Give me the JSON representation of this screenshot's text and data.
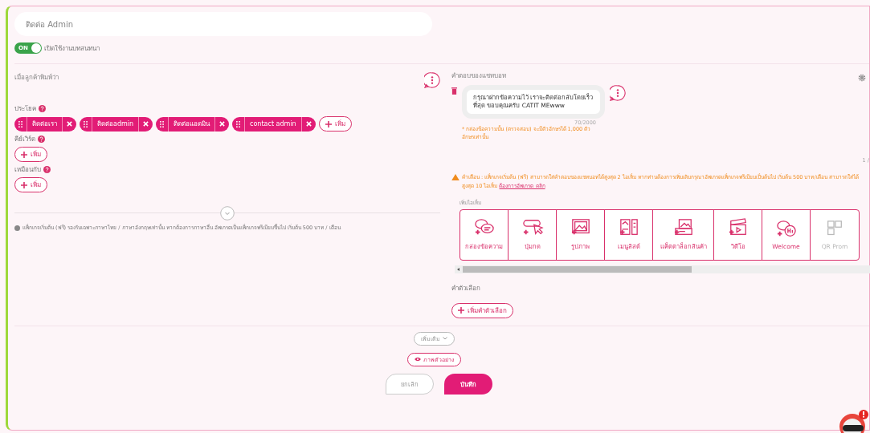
{
  "title_field": {
    "value": "ติดต่อ Admin"
  },
  "toggle": {
    "on": true,
    "label": "ON",
    "text": "เปิดใช้งานบทสนทนา"
  },
  "trigger": {
    "heading": "เมื่อลูกค้าพิมพ์ว่า",
    "groups": [
      {
        "label": "ประโยค",
        "add": "เพิ่ม",
        "tags": [
          "ติดต่อเรา",
          "ติดต่อadmin",
          "ติดต่อแอดมิน",
          "contact admin"
        ]
      },
      {
        "label": "คีย์เวิร์ด",
        "add": "เพิ่ม"
      },
      {
        "label": "เหมือนกับ",
        "add": "เพิ่ม"
      }
    ],
    "note": "แพ็กเกจเริ่มต้น (ฟรี) รองรับเฉพาะภาษาไทย / ภาษาอังกฤษเท่านั้น หากต้องการภาษาอื่น อัพเกรดเป็นแพ็กเกจพรีเมียมขึ้นไป เริ่มต้น 500 บาท / เดือน"
  },
  "reply": {
    "heading": "คำตอบของแชทบอท",
    "message": "กรุณาฝากข้อความไว้ เราจะติดต่อกลับโดยเร็วที่สุด ขอบคุณครับ CATIT MEwww",
    "counter": "70/2000",
    "hint": "* กล่องข้อความนั้น (ตรวจสอบ) จะมีตัวอักษรได้ 1,000 ตัวอักษรเท่านั้น",
    "pager": "1 /",
    "warning": "คำเตือน : แพ็กเกจเริ่มต้น (ฟรี) สามารถใส่คำตอบของแชทบอทได้สูงสุด 2 ไอเท็ม หากท่านต้องการเพิ่มเติมกรุณาอัพเกรดแพ็กเกจพรีเมียมเป็นต้นไป เริ่มต้น 500 บาท/เดือน สามารถใส่ได้สูงสุด 10 ไอเท็ม",
    "warning_link": "ต้องการอัพเกรด คลิก",
    "add_label": "เพิ่มไอเท็ม",
    "items": [
      {
        "kind": "text",
        "label": "กล่องข้อความ",
        "disabled": false
      },
      {
        "kind": "button",
        "label": "ปุ่มกด",
        "disabled": false
      },
      {
        "kind": "image",
        "label": "รูปภาพ",
        "disabled": false
      },
      {
        "kind": "menu",
        "label": "เมนูลิสต์",
        "disabled": false
      },
      {
        "kind": "catalog",
        "label": "แค็ตตาล็อกสินค้า",
        "disabled": false
      },
      {
        "kind": "video",
        "label": "วิดีโอ",
        "disabled": false
      },
      {
        "kind": "welcome",
        "label": "Welcome",
        "disabled": false
      },
      {
        "kind": "qr",
        "label": "QR Prom",
        "disabled": true
      }
    ],
    "options_heading": "คำตัวเลือก",
    "options_add": "เพิ่มคำตัวเลือก"
  },
  "more": "เพิ่มเติม",
  "preview": "ภาพตัวอย่าง",
  "cancel": "ยกเลิก",
  "save": "บันทึก"
}
